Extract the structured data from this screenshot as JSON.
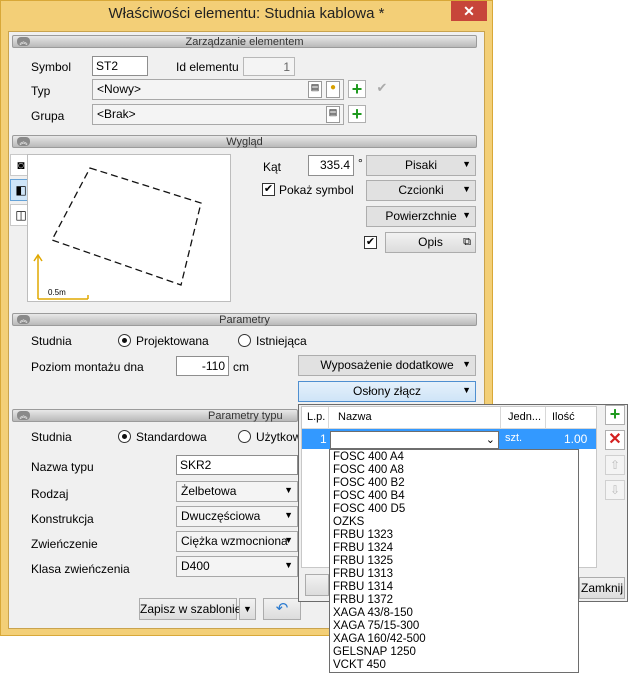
{
  "window": {
    "title": "Właściwości elementu: Studnia kablowa *",
    "close_label": "✕"
  },
  "sections": {
    "manage": "Zarządzanie elementem",
    "look": "Wygląd",
    "params": "Parametry",
    "type_params": "Parametry typu"
  },
  "manage": {
    "symbol_label": "Symbol",
    "symbol_value": "ST2",
    "id_label": "Id elementu",
    "id_value": "1",
    "typ_label": "Typ",
    "typ_value": "<Nowy>",
    "grupa_label": "Grupa",
    "grupa_value": "<Brak>"
  },
  "look": {
    "kat_label": "Kąt",
    "kat_value": "335.4",
    "kat_unit": "°",
    "show_symbol_label": "Pokaż symbol",
    "pisaki": "Pisaki",
    "czcionki": "Czcionki",
    "powierzchnie": "Powierzchnie",
    "opis": "Opis",
    "scale_label": "0.5m"
  },
  "params": {
    "studnia_label": "Studnia",
    "opt_projected": "Projektowana",
    "opt_existing": "Istniejąca",
    "poziom_label": "Poziom montażu dna",
    "poziom_value": "-110",
    "poziom_unit": "cm",
    "wyposazenie": "Wyposażenie dodatkowe",
    "oslony": "Osłony złącz"
  },
  "type_params": {
    "studnia_label": "Studnia",
    "opt_standard": "Standardowa",
    "opt_user": "Użytkow",
    "nazwa_typu_label": "Nazwa typu",
    "nazwa_typu_value": "SKR2",
    "rodzaj_label": "Rodzaj",
    "rodzaj_value": "Żelbetowa",
    "konstrukcja_label": "Konstrukcja",
    "konstrukcja_value": "Dwuczęściowa",
    "zwienczenie_label": "Zwieńczenie",
    "zwienczenie_value": "Ciężka wzmocniona",
    "klasa_label": "Klasa zwieńczenia",
    "klasa_value": "D400"
  },
  "bottom": {
    "save_template": "Zapisz w szablonie",
    "close": "Zamknij"
  },
  "popup_grid": {
    "headers": {
      "lp": "L.p.",
      "nazwa": "Nazwa",
      "jedn": "Jedn...",
      "ilosc": "Ilość"
    },
    "row": {
      "lp": "1",
      "nazwa": "",
      "jedn": "szt.",
      "ilosc": "1.00"
    }
  },
  "listbox": {
    "options": [
      "FOSC 400 A4",
      "FOSC 400 A8",
      "FOSC 400 B2",
      "FOSC 400 B4",
      "FOSC 400 D5",
      "OZKS",
      "FRBU 1323",
      "FRBU 1324",
      "FRBU 1325",
      "FRBU 1313",
      "FRBU 1314",
      "FRBU 1372",
      "XAGA 43/8-150",
      "XAGA 75/15-300",
      "XAGA 160/42-500",
      "GELSNAP 1250",
      "VCKT 450"
    ]
  },
  "colors": {
    "window_frame": "#f3cf77",
    "close_button": "#c7453a",
    "selection": "#3399ff",
    "add_green": "#1f9a1f",
    "delete_red": "#d42020"
  }
}
